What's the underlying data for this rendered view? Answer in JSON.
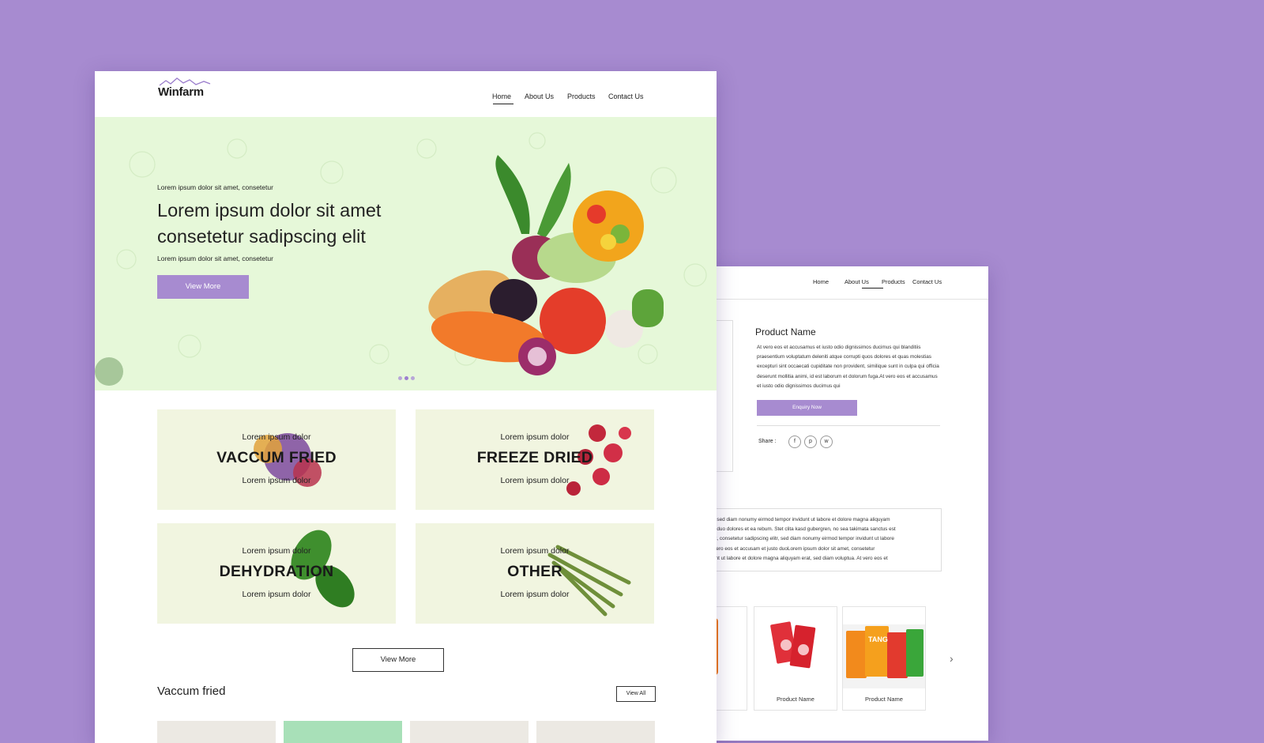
{
  "back_page": {
    "nav": {
      "home": "Home",
      "about": "About Us",
      "products": "Products",
      "contact": "Contact Us"
    },
    "product_name": "Product Name",
    "description": "At vero eos et accusamus et iusto odio dignissimos ducimus qui blanditiis praesentium voluptatum deleniti atque corrupti quos dolores et quas molestias excepturi sint occaecati cupiditate non provident, similique sunt in culpa qui officia deserunt mollitia animi, id est laborum et dolorum fuga.At vero eos et accusamus et iusto odio dignissimos ducimus qui",
    "enquiry_label": "Enquiry Now",
    "share_label": "Share :",
    "social": [
      "f",
      "p",
      "w"
    ],
    "long_text": [
      "ng elitr, sed diam nonumy eirmod tempor invidunt ut labore et dolore magna aliquyam",
      "et justo duo dolores et ea rebum. Stet clita kasd gubergren, no sea takimata sanctus est",
      "sit amet, consetetur sadipscing elitr, sed diam nonumy eirmod tempor invidunt ut labore",
      "ua. At vero eos et accusam et justo duoLorem ipsum dolor sit amet, consetetur",
      "r invidunt ut labore et dolore magna aliquyam erat, sed diam voluptua. At vero eos et"
    ],
    "products": [
      {
        "label": "ct Name"
      },
      {
        "label": "Product Name"
      },
      {
        "label": "Product Name"
      }
    ],
    "next_icon": "chevron-right-icon"
  },
  "front_page": {
    "logo": "Winfarm",
    "nav": {
      "home": "Home",
      "about": "About Us",
      "products": "Products",
      "contact": "Contact Us"
    },
    "hero": {
      "eyebrow": "Lorem ipsum dolor sit amet, consetetur",
      "title": "Lorem ipsum dolor sit amet consetetur sadipscing elit",
      "subtitle": "Lorem ipsum dolor sit amet, consetetur",
      "button": "View More"
    },
    "categories": [
      {
        "top": "Lorem ipsum dolor",
        "name": "VACCUM FRIED",
        "bottom": "Lorem ipsum dolor"
      },
      {
        "top": "Lorem ipsum dolor",
        "name": "FREEZE DRIED",
        "bottom": "Lorem ipsum dolor"
      },
      {
        "top": "Lorem ipsum dolor",
        "name": "DEHYDRATION",
        "bottom": "Lorem ipsum dolor"
      },
      {
        "top": "Lorem ipsum dolor",
        "name": "OTHER",
        "bottom": "Lorem ipsum dolor"
      }
    ],
    "view_more": "View More",
    "section_title": "Vaccum fried",
    "view_all": "View All"
  },
  "colors": {
    "background": "#a78bd0",
    "accent": "#a78bd0",
    "hero_bg": "#e6f8d9"
  }
}
